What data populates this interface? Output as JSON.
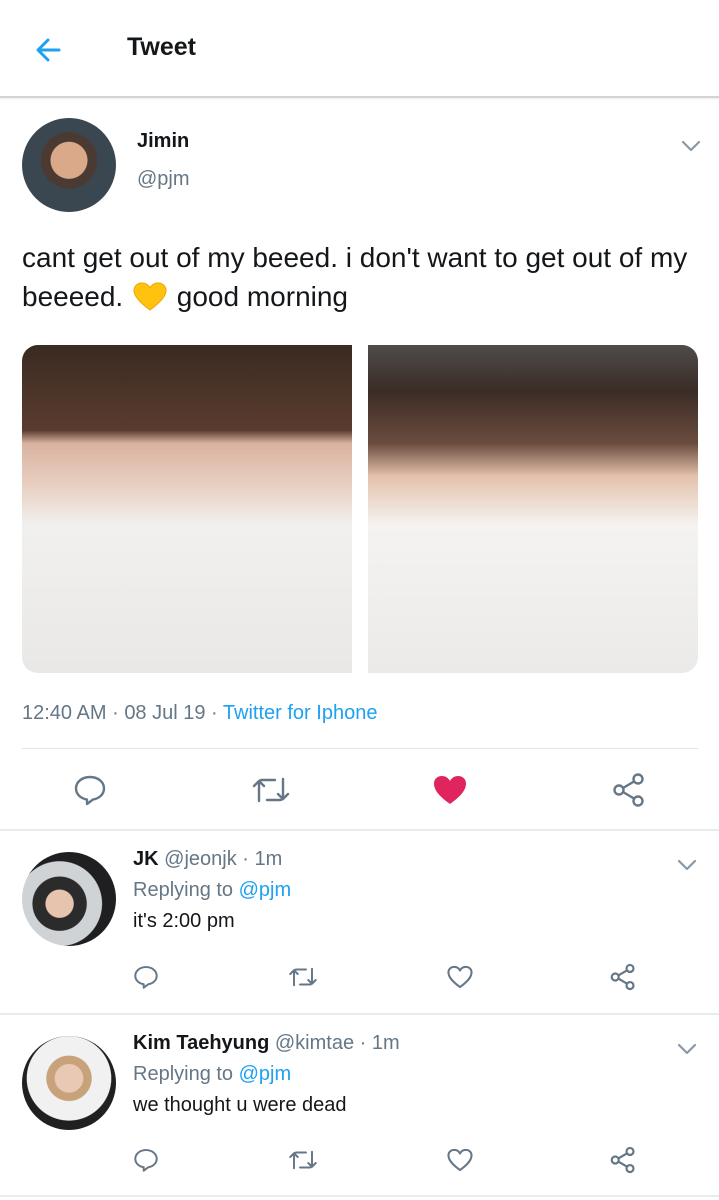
{
  "header": {
    "title": "Tweet",
    "back_icon": "arrow-left-icon",
    "accent": "#1da1f2"
  },
  "tweet": {
    "author": {
      "name": "Jimin",
      "handle": "@pjm"
    },
    "text_before": "cant get out of my beeed. i don't want to get out of my beeeed.",
    "emoji": "yellow-heart-emoji",
    "text_after": "good morning",
    "time": "12:40 AM",
    "date": "08 Jul 19",
    "separator": "·",
    "source": "Twitter for Iphone",
    "liked": true,
    "like_color": "#e0245e"
  },
  "replies": [
    {
      "name": "JK",
      "handle": "@jeonjk",
      "time_sep": "·",
      "time": "1m",
      "replying_label": "Replying to",
      "replying_to": "@pjm",
      "text": "it's 2:00 pm"
    },
    {
      "name": "Kim Taehyung",
      "handle": "@kimtae",
      "time_sep": "·",
      "time": "1m",
      "replying_label": "Replying to",
      "replying_to": "@pjm",
      "text": "we thought u were dead"
    }
  ]
}
